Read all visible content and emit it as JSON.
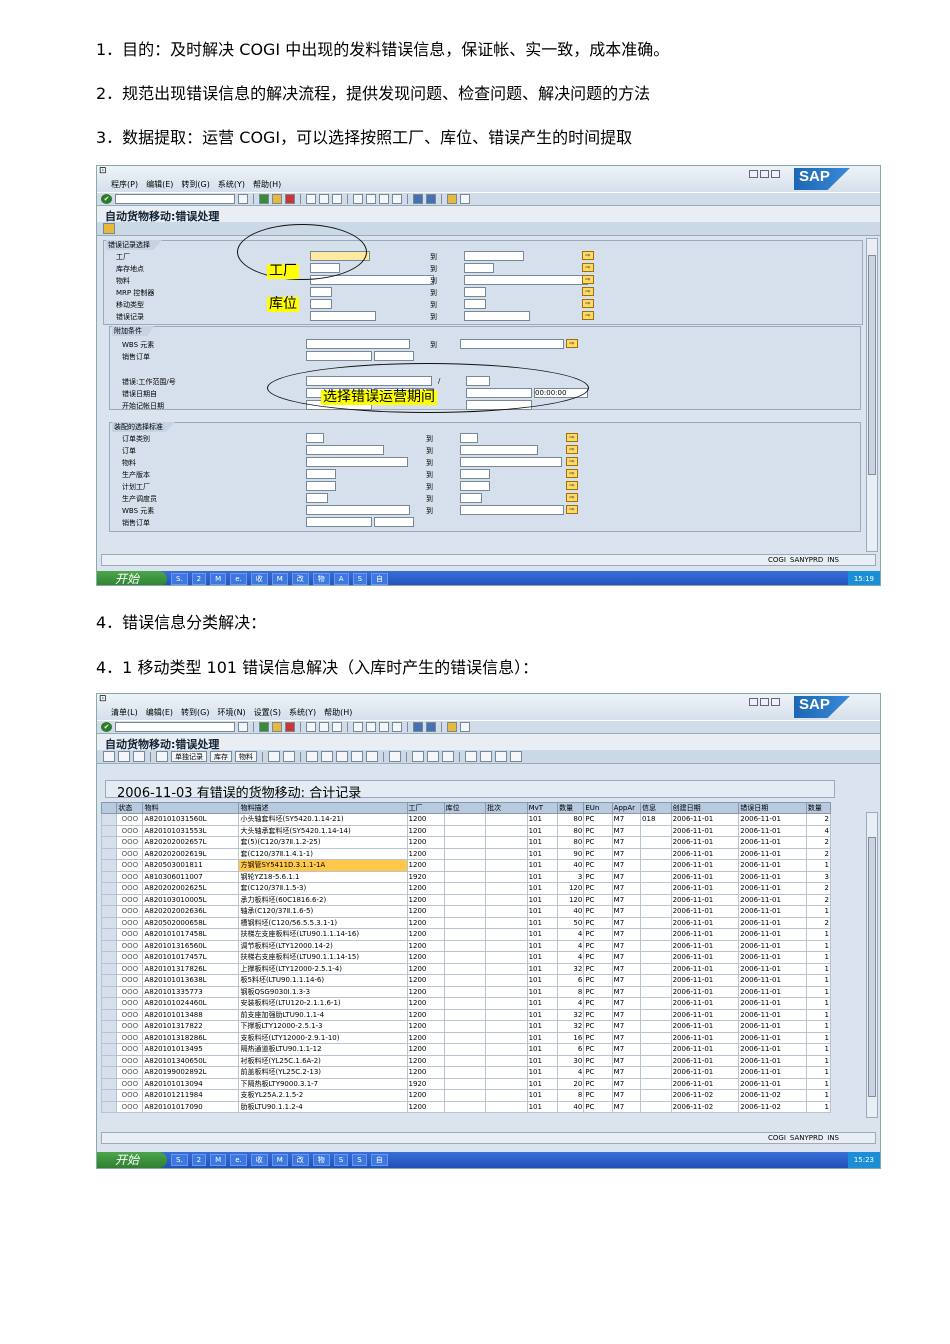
{
  "paragraphs": {
    "p1": "1．目的：及时解决 COGI 中出现的发料错误信息，保证帐、实一致，成本准确。",
    "p2": "2．规范出现错误信息的解决流程，提供发现问题、检查问题、解决问题的方法",
    "p3": "3．数据提取：运营 COGI，可以选择按照工厂、库位、错误产生的时间提取",
    "p4": "4．错误信息分类解决：",
    "p5": "4．1  移动类型 101 错误信息解决（入库时产生的错误信息）："
  },
  "screen1": {
    "menu": [
      "程序(P)",
      "编辑(E)",
      "转到(G)",
      "系统(Y)",
      "帮助(H)"
    ],
    "logo": "SAP",
    "page_title": "自动货物移动:错误处理",
    "group_selection": "错误记录选择",
    "fields": [
      "工厂",
      "库存地点",
      "物料",
      "MRP 控制器",
      "移动类型",
      "错误记录"
    ],
    "to_label": "到",
    "group_additional": "附加条件",
    "additional_fields": [
      "WBS 元素",
      "销售订单"
    ],
    "extra_fields": [
      "错误:工作范围/号",
      "错误日期自",
      "开始记帐日期"
    ],
    "slash": "/",
    "time_value": "00:00:00",
    "group_assembly": "装配的选择标准",
    "assembly_fields": [
      "订单类别",
      "订单",
      "物料",
      "生产版本",
      "计划工厂",
      "生产调度员",
      "WBS 元素",
      "销售订单"
    ],
    "annotations": {
      "plant": "工厂",
      "storage": "库位",
      "period": "选择错误运营期间"
    },
    "status": {
      "tcode": "COGI",
      "system": "SANYPRD",
      "mode": "INS"
    },
    "start_label": "开始",
    "clock": "15:19"
  },
  "screen2": {
    "menu": [
      "清单(L)",
      "编辑(E)",
      "转到(G)",
      "环境(N)",
      "设置(S)",
      "系统(Y)",
      "帮助(H)"
    ],
    "logo": "SAP",
    "page_title": "自动货物移动:错误处理",
    "buttons": [
      "单独记录",
      "库存",
      "物料"
    ],
    "report_title": "2006-11-03 有错误的货物移动:  合计记录",
    "columns": [
      "状态",
      "物料",
      "物料描述",
      "工厂",
      "库位",
      "批次",
      "MvT",
      "数量",
      "EUn",
      "AppAr",
      "信息",
      "创建日期",
      "错误日期",
      "数量"
    ],
    "rows": [
      [
        "ΟΟΟ",
        "A820101031560L",
        "小头轴套料坯(SY5420.1.14-21)",
        "1200",
        "",
        "",
        "101",
        "80",
        "PC",
        "M7",
        "018",
        "2006-11-01",
        "2006-11-01",
        "2"
      ],
      [
        "ΟΟΟ",
        "A820101031553L",
        "大头轴承套料坯(SY5420.1.14-14)",
        "1200",
        "",
        "",
        "101",
        "80",
        "PC",
        "M7",
        "",
        "2006-11-01",
        "2006-11-01",
        "4"
      ],
      [
        "ΟΟΟ",
        "A820202002657L",
        "套(5)(C120/37Ⅱ.1.2-25)",
        "1200",
        "",
        "",
        "101",
        "80",
        "PC",
        "M7",
        "",
        "2006-11-01",
        "2006-11-01",
        "2"
      ],
      [
        "ΟΟΟ",
        "A820202002619L",
        "套(C120/37Ⅱ.1.4.1-1)",
        "1200",
        "",
        "",
        "101",
        "90",
        "PC",
        "M7",
        "",
        "2006-11-01",
        "2006-11-01",
        "2"
      ],
      [
        "ΟΟΟ",
        "A820503001811",
        "方钢管SY5411D.3.1.1-1A",
        "1200",
        "",
        "",
        "101",
        "40",
        "PC",
        "M7",
        "",
        "2006-11-01",
        "2006-11-01",
        "1"
      ],
      [
        "ΟΟΟ",
        "A810306011007",
        "钢轮YZ18-5.6.1.1",
        "1920",
        "",
        "",
        "101",
        "3",
        "PC",
        "M7",
        "",
        "2006-11-01",
        "2006-11-01",
        "3"
      ],
      [
        "ΟΟΟ",
        "A820202002625L",
        "套(C120/37Ⅱ.1.5-3)",
        "1200",
        "",
        "",
        "101",
        "120",
        "PC",
        "M7",
        "",
        "2006-11-01",
        "2006-11-01",
        "2"
      ],
      [
        "ΟΟΟ",
        "A820103010005L",
        "承力板料坯(60C1816.6-2)",
        "1200",
        "",
        "",
        "101",
        "120",
        "PC",
        "M7",
        "",
        "2006-11-01",
        "2006-11-01",
        "2"
      ],
      [
        "ΟΟΟ",
        "A820202002636L",
        "轴承(C120/37Ⅱ.1.6-5)",
        "1200",
        "",
        "",
        "101",
        "40",
        "PC",
        "M7",
        "",
        "2006-11-01",
        "2006-11-01",
        "1"
      ],
      [
        "ΟΟΟ",
        "A820502000658L",
        "槽钢料坯(C120/56.5.5.3.1-1)",
        "1200",
        "",
        "",
        "101",
        "50",
        "PC",
        "M7",
        "",
        "2006-11-01",
        "2006-11-01",
        "2"
      ],
      [
        "ΟΟΟ",
        "A820101017458L",
        "扶梯左支座板料坯(LTU90.1.1.14-16)",
        "1200",
        "",
        "",
        "101",
        "4",
        "PC",
        "M7",
        "",
        "2006-11-01",
        "2006-11-01",
        "1"
      ],
      [
        "ΟΟΟ",
        "A820101316560L",
        "调节板料坯(LTY12000.14-2)",
        "1200",
        "",
        "",
        "101",
        "4",
        "PC",
        "M7",
        "",
        "2006-11-01",
        "2006-11-01",
        "1"
      ],
      [
        "ΟΟΟ",
        "A820101017457L",
        "扶梯右支座板料坯(LTU90.1.1.14-15)",
        "1200",
        "",
        "",
        "101",
        "4",
        "PC",
        "M7",
        "",
        "2006-11-01",
        "2006-11-01",
        "1"
      ],
      [
        "ΟΟΟ",
        "A820101317826L",
        "上撑板料坯(LTY12000-2.5.1-4)",
        "1200",
        "",
        "",
        "101",
        "32",
        "PC",
        "M7",
        "",
        "2006-11-01",
        "2006-11-01",
        "1"
      ],
      [
        "ΟΟΟ",
        "A820101013638L",
        "板5料坯(LTU90.1.1.14-6)",
        "1200",
        "",
        "",
        "101",
        "6",
        "PC",
        "M7",
        "",
        "2006-11-01",
        "2006-11-01",
        "1"
      ],
      [
        "ΟΟΟ",
        "A820101335773",
        "钢板QSG9030Ⅰ.1.3-3",
        "1200",
        "",
        "",
        "101",
        "8",
        "PC",
        "M7",
        "",
        "2006-11-01",
        "2006-11-01",
        "1"
      ],
      [
        "ΟΟΟ",
        "A820101024460L",
        "安装板料坯(LTU120-2.1.1.6-1)",
        "1200",
        "",
        "",
        "101",
        "4",
        "PC",
        "M7",
        "",
        "2006-11-01",
        "2006-11-01",
        "1"
      ],
      [
        "ΟΟΟ",
        "A820101013488",
        "前支座加强肋LTU90.1.1-4",
        "1200",
        "",
        "",
        "101",
        "32",
        "PC",
        "M7",
        "",
        "2006-11-01",
        "2006-11-01",
        "1"
      ],
      [
        "ΟΟΟ",
        "A820101317822",
        "下撑板LTY12000-2.5.1-3",
        "1200",
        "",
        "",
        "101",
        "32",
        "PC",
        "M7",
        "",
        "2006-11-01",
        "2006-11-01",
        "1"
      ],
      [
        "ΟΟΟ",
        "A820101318286L",
        "支板料坯(LTY12000-2.9.1-10)",
        "1200",
        "",
        "",
        "101",
        "16",
        "PC",
        "M7",
        "",
        "2006-11-01",
        "2006-11-01",
        "1"
      ],
      [
        "ΟΟΟ",
        "A820101013495",
        "隔热通道板LTU90.1.1-12",
        "1200",
        "",
        "",
        "101",
        "6",
        "PC",
        "M7",
        "",
        "2006-11-01",
        "2006-11-01",
        "1"
      ],
      [
        "ΟΟΟ",
        "A820101340650L",
        "衬板料坯(YL25C.1.6A-2)",
        "1200",
        "",
        "",
        "101",
        "30",
        "PC",
        "M7",
        "",
        "2006-11-01",
        "2006-11-01",
        "1"
      ],
      [
        "ΟΟΟ",
        "A820199002892L",
        "前盖板料坯(YL25C.2-13)",
        "1200",
        "",
        "",
        "101",
        "4",
        "PC",
        "M7",
        "",
        "2006-11-01",
        "2006-11-01",
        "1"
      ],
      [
        "ΟΟΟ",
        "A820101013094",
        "下隔热板LTY9000.3.1-7",
        "1920",
        "",
        "",
        "101",
        "20",
        "PC",
        "M7",
        "",
        "2006-11-01",
        "2006-11-01",
        "1"
      ],
      [
        "ΟΟΟ",
        "A820101211984",
        "支板YL25A.2.1.5-2",
        "1200",
        "",
        "",
        "101",
        "8",
        "PC",
        "M7",
        "",
        "2006-11-02",
        "2006-11-02",
        "1"
      ],
      [
        "ΟΟΟ",
        "A820101017090",
        "肋板LTU90.1.1.2-4",
        "1200",
        "",
        "",
        "101",
        "40",
        "PC",
        "M7",
        "",
        "2006-11-02",
        "2006-11-02",
        "1"
      ]
    ],
    "status": {
      "tcode": "COGI",
      "system": "SANYPRD",
      "mode": "INS"
    },
    "start_label": "开始",
    "clock": "15:23"
  }
}
